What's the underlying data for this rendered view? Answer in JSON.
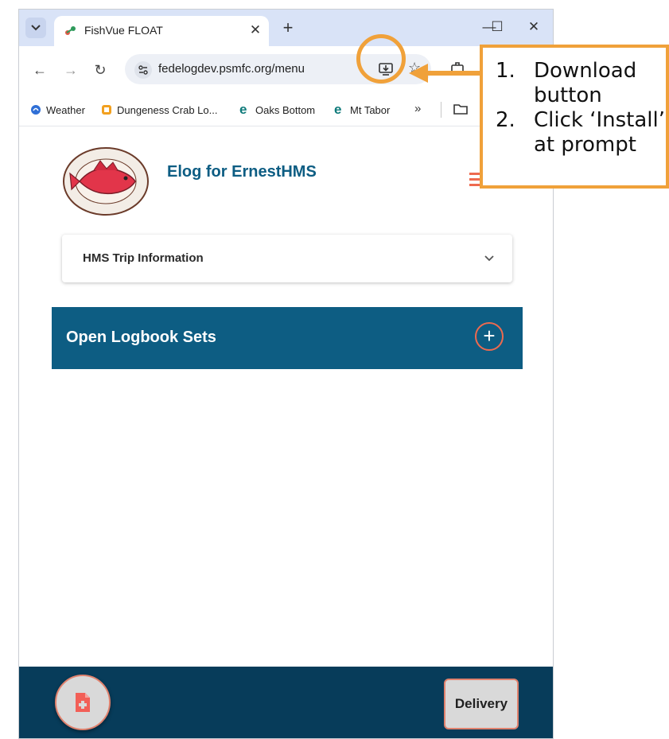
{
  "browser": {
    "tab_title": "FishVue FLOAT",
    "url": "fedelogdev.psmfc.org/menu",
    "bookmarks": [
      {
        "label": "Weather",
        "icon": "weather-icon"
      },
      {
        "label": "Dungeness Crab Lo...",
        "icon": "crab-log-icon"
      },
      {
        "label": "Oaks Bottom",
        "icon": "edge-icon"
      },
      {
        "label": "Mt Tabor",
        "icon": "edge-icon"
      }
    ],
    "more_bookmarks": "»"
  },
  "app": {
    "title": "Elog for ErnestHMS",
    "trip_section_label": "HMS Trip Information",
    "logbook_sets_label": "Open Logbook Sets",
    "delivery_button": "Delivery",
    "colors": {
      "primary": "#0d5d83",
      "accent": "#ee6a4f",
      "footer": "#073c5a"
    }
  },
  "annotation": {
    "steps": [
      {
        "num": "1.",
        "line1": "Download",
        "line2": "button"
      },
      {
        "num": "2.",
        "line1": "Click ‘Install’",
        "line2": "at prompt"
      }
    ],
    "color": "#f0a13a"
  }
}
